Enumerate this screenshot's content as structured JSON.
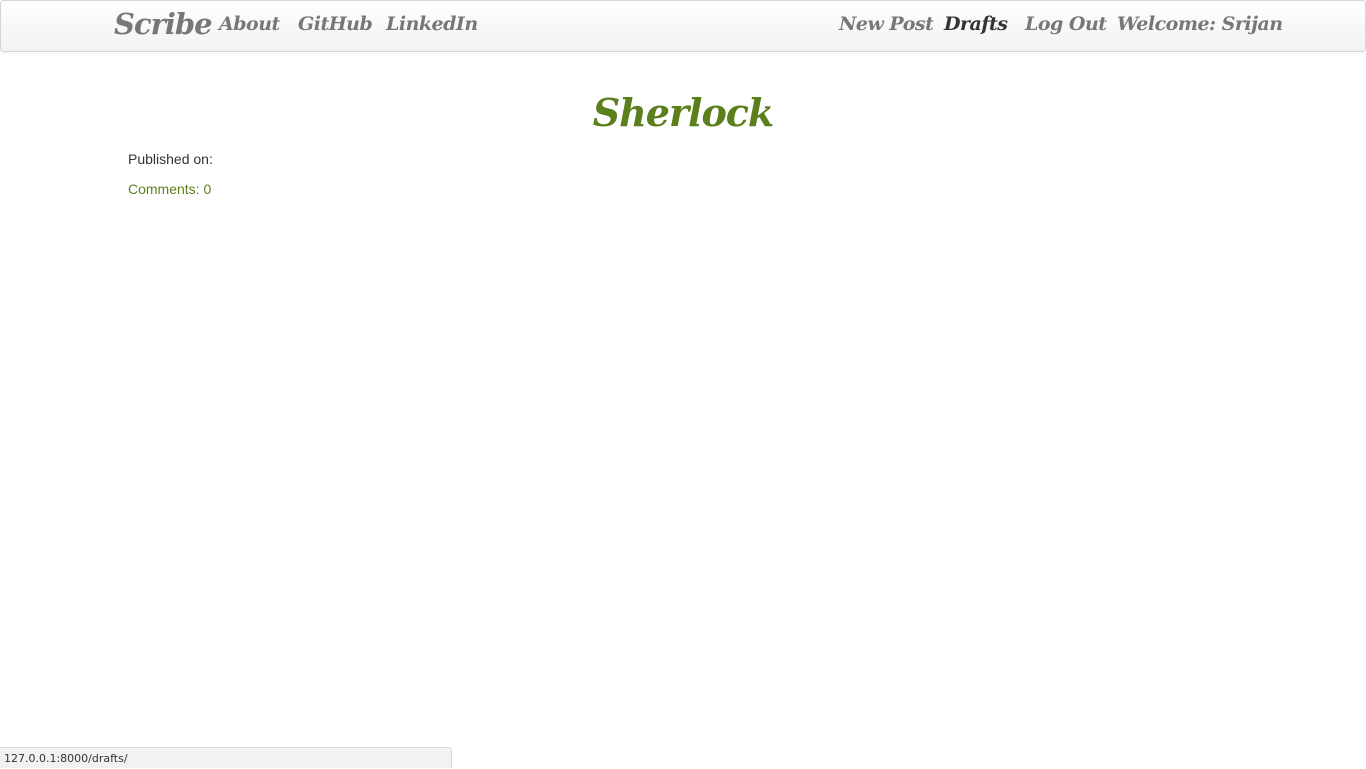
{
  "navbar": {
    "brand": "Scribe",
    "left_links": [
      "About",
      "GitHub",
      "LinkedIn"
    ],
    "right_links": [
      "New Post",
      "Drafts",
      "Log Out"
    ],
    "welcome": "Welcome: Srijan",
    "active": "Drafts"
  },
  "post": {
    "title": "Sherlock",
    "published_label": "Published on:",
    "published_value": "",
    "comments_label": "Comments: 0"
  },
  "status_bar": {
    "url": "127.0.0.1:8000/drafts/"
  },
  "colors": {
    "accent_green": "#5a7f1b",
    "nav_text": "#777777",
    "nav_active": "#333333"
  }
}
